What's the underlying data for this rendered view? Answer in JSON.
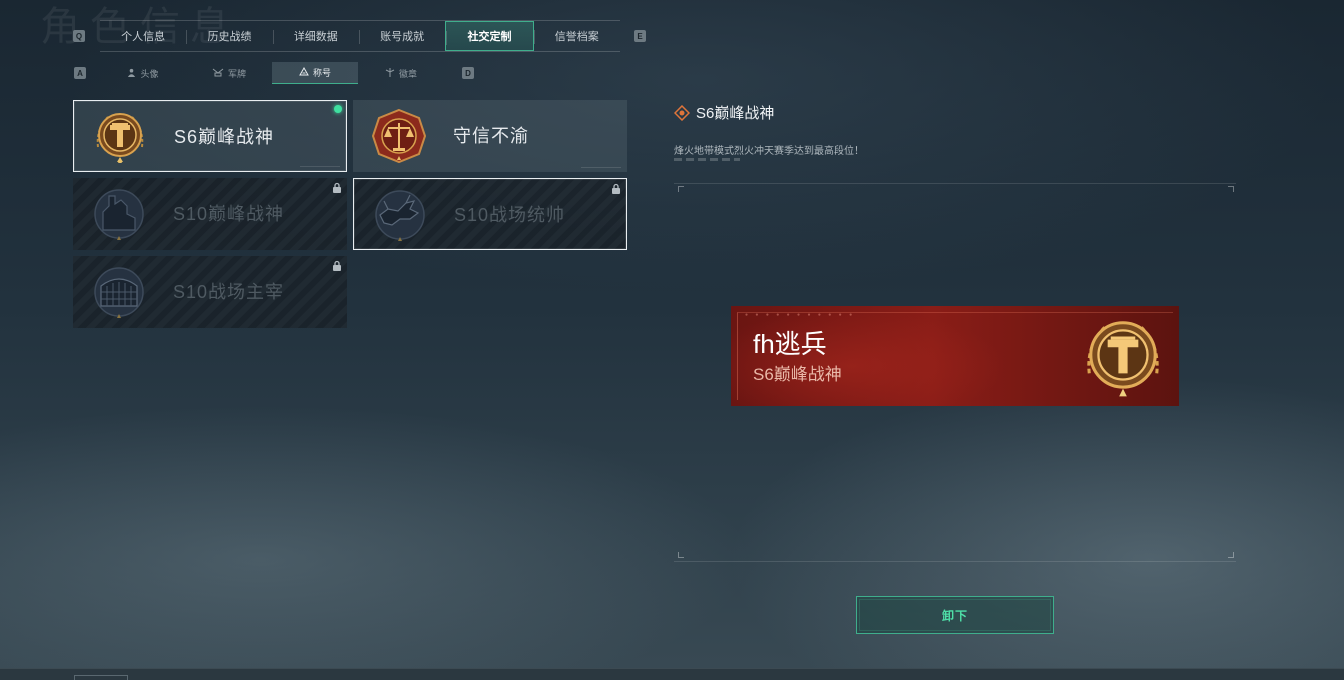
{
  "header": {
    "watermark_title": "角色信息",
    "left_key": "Q",
    "right_key": "E",
    "tabs": [
      {
        "label": "个人信息"
      },
      {
        "label": "历史战绩"
      },
      {
        "label": "详细数据"
      },
      {
        "label": "账号成就"
      },
      {
        "label": "社交定制",
        "active": true
      },
      {
        "label": "信誉档案"
      }
    ]
  },
  "subnav": {
    "left_key": "A",
    "right_key": "D",
    "tabs": [
      {
        "label": "头像",
        "icon": "person-icon"
      },
      {
        "label": "军牌",
        "icon": "dogtag-icon"
      },
      {
        "label": "称号",
        "icon": "title-icon",
        "active": true
      },
      {
        "label": "徽章",
        "icon": "badge-icon"
      }
    ]
  },
  "titles": [
    {
      "name": "S6巅峰战神",
      "locked": false,
      "equipped": true,
      "selected": true,
      "emblem": "pillar-emblem"
    },
    {
      "name": "守信不渝",
      "locked": false,
      "equipped": false,
      "selected": false,
      "emblem": "scales-emblem"
    },
    {
      "name": "S10巅峰战神",
      "locked": true,
      "equipped": false,
      "selected": false,
      "emblem": "fortress-emblem"
    },
    {
      "name": "S10战场统帅",
      "locked": true,
      "equipped": false,
      "selected": true,
      "emblem": "beast-emblem"
    },
    {
      "name": "S10战场主宰",
      "locked": true,
      "equipped": false,
      "selected": false,
      "emblem": "colosseum-emblem"
    }
  ],
  "detail": {
    "title": "S6巅峰战神",
    "description": "烽火地带模式烈火冲天赛季达到最高段位！"
  },
  "nameplate": {
    "player_name": "fh逃兵",
    "title": "S6巅峰战神"
  },
  "actions": {
    "unequip_label": "卸下"
  },
  "colors": {
    "accent": "#3fae8c",
    "equipped_dot": "#3fe0a0",
    "gold": "#c88a3a",
    "plate_red": "#8a1d17"
  }
}
